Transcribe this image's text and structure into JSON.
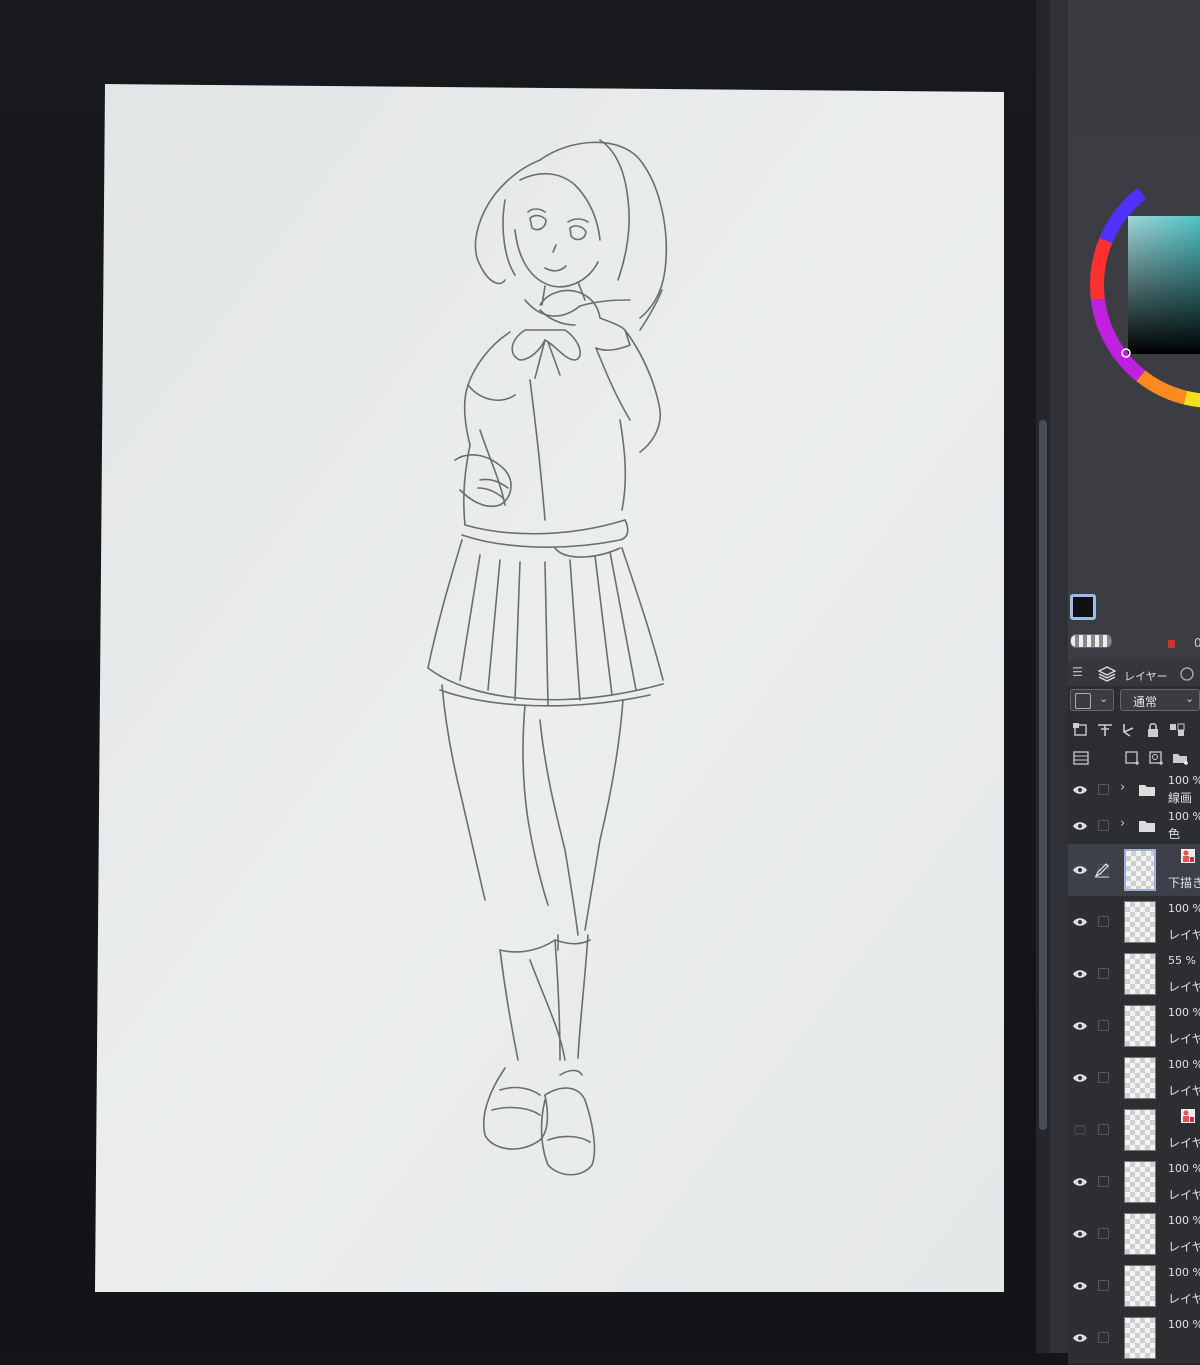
{
  "panel": {
    "layer_tab_label": "レイヤー",
    "blend_mode": "通常",
    "color_value": "0",
    "menu_glyph": "☰"
  },
  "colors": {
    "paper": "#e7ebea",
    "workspace": "#131519",
    "panel_bg": "#2f3136",
    "selected_layer": "#3d4049",
    "main_color": "#111111"
  },
  "layers": [
    {
      "opacity": "100 %",
      "name": "線画",
      "type": "folder"
    },
    {
      "opacity": "100 %",
      "name": "色",
      "type": "folder"
    },
    {
      "opacity": "",
      "name": "下描き",
      "type": "layer",
      "selected": true,
      "icon": "reference-icon"
    },
    {
      "opacity": "100 %",
      "name": "レイヤー",
      "type": "layer"
    },
    {
      "opacity": "55 %",
      "name": "レイヤー",
      "type": "layer"
    },
    {
      "opacity": "100 %",
      "name": "レイヤー",
      "type": "layer"
    },
    {
      "opacity": "100 %",
      "name": "レイヤー",
      "type": "layer"
    },
    {
      "opacity": "",
      "name": "レイヤー",
      "type": "layer",
      "hidden": true,
      "icon": "reference-icon"
    },
    {
      "opacity": "100 %",
      "name": "レイヤー",
      "type": "layer"
    },
    {
      "opacity": "100 %",
      "name": "レイヤー",
      "type": "layer"
    },
    {
      "opacity": "100 %",
      "name": "レイヤー",
      "type": "layer"
    },
    {
      "opacity": "100 %",
      "name": "",
      "type": "layer"
    }
  ]
}
